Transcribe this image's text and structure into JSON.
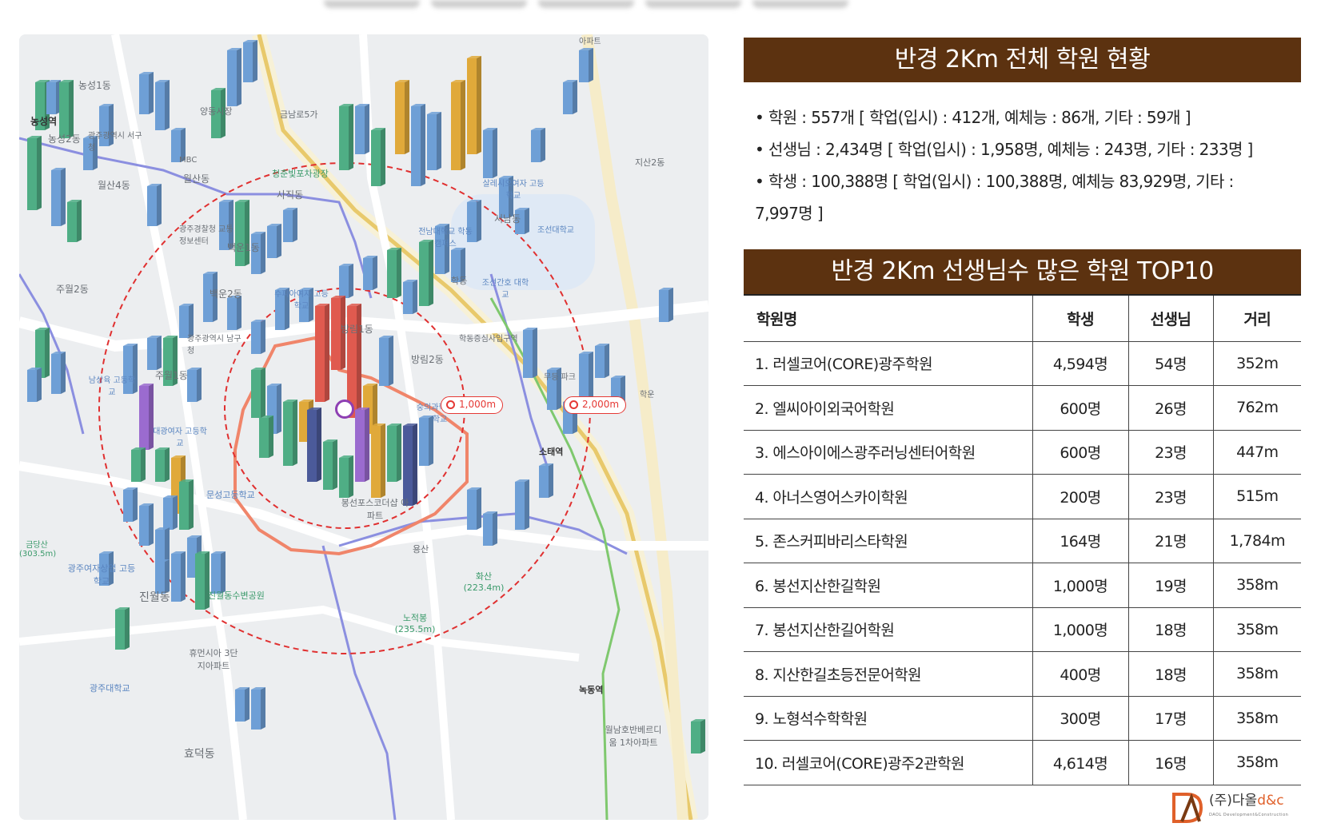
{
  "summary": {
    "title": "반경 2Km 전체 학원 현황",
    "lines": [
      "• 학원 : 557개 [ 학업(입시) : 412개, 예체능 : 86개, 기타 : 59개 ]",
      "• 선생님 : 2,434명 [ 학업(입시) : 1,958명, 예체능 : 243명, 기타 : 233명 ]",
      "• 학생 : 100,388명 [ 학업(입시) : 100,388명, 예체능 83,929명, 기타 :",
      "7,997명 ]"
    ]
  },
  "top10": {
    "title": "반경 2Km 선생님수 많은 학원 TOP10",
    "headers": [
      "학원명",
      "학생",
      "선생님",
      "거리"
    ],
    "rows": [
      {
        "name": "1. 러셀코어(CORE)광주학원",
        "students": "4,594명",
        "teachers": "54명",
        "distance": "352m"
      },
      {
        "name": "2. 엘씨아이외국어학원",
        "students": "600명",
        "teachers": "26명",
        "distance": "762m"
      },
      {
        "name": "3. 에스아이에스광주러닝센터어학원",
        "students": "600명",
        "teachers": "23명",
        "distance": "447m"
      },
      {
        "name": "4. 아너스영어스카이학원",
        "students": "200명",
        "teachers": "23명",
        "distance": "515m"
      },
      {
        "name": "5. 존스커피바리스타학원",
        "students": "164명",
        "teachers": "21명",
        "distance": "1,784m"
      },
      {
        "name": "6. 봉선지산한길학원",
        "students": "1,000명",
        "teachers": "19명",
        "distance": "358m"
      },
      {
        "name": "7. 봉선지산한길어학원",
        "students": "1,000명",
        "teachers": "18명",
        "distance": "358m"
      },
      {
        "name": "8. 지산한길초등전문어학원",
        "students": "400명",
        "teachers": "18명",
        "distance": "358m"
      },
      {
        "name": "9. 노형석수학학원",
        "students": "300명",
        "teachers": "17명",
        "distance": "358m"
      },
      {
        "name": "10. 러셀코어(CORE)광주2관학원",
        "students": "4,614명",
        "teachers": "16명",
        "distance": "358m"
      }
    ]
  },
  "map": {
    "radius_badges": [
      "1,000m",
      "2,000m"
    ],
    "labels": {
      "l1": "농성1동",
      "l2": "농성역",
      "l3": "농성2동",
      "l4": "광주광역시 서구청",
      "l5": "MBC",
      "l6": "월산동",
      "l7": "양동시장",
      "l8": "금남로5가",
      "l9": "청춘빛포차광장",
      "l10": "사직동",
      "l11": "광주경찰청 교통정보센터",
      "l12": "주월2동",
      "l13": "월산4동",
      "l14": "백운1동",
      "l15": "백운2동",
      "l16": "광주광역시 남구청",
      "l17": "주월1동",
      "l18": "방림1동",
      "l19": "방림2동",
      "l20": "봉선포스코더샵 아파트",
      "l21": "문성고등학교",
      "l22": "광주여자상업 고등학교",
      "l23": "진월동",
      "l24": "진월동수변공원",
      "l25": "휴먼시아 3단지아파트",
      "l26": "광주대학교",
      "l27": "효덕동",
      "l28": "용산",
      "l29": "서남동",
      "l30": "전남대학교 학동캠퍼스",
      "l31": "조선대학교",
      "l32": "살레시오여자 고등학교",
      "l33": "조선간호 대학교",
      "l34": "학동증심사입구역",
      "l35": "소태역",
      "l36": "녹동역",
      "l37": "월남호반베르디움 1차아파트",
      "l38": "지산2동",
      "l39": "학운",
      "l40": "숭의과학 고등학교",
      "l41": "수피아여자 고등학교",
      "l42": "대광여자 고등학교",
      "l43": "남상육 고등학교",
      "l44": "금당산 (303.5m)",
      "l45": "화산 (223.4m)",
      "l46": "노적봉 (235.5m)",
      "l47": "학동",
      "l48": "무등 파크",
      "l49": "아파트"
    }
  },
  "logo": {
    "name_prefix": "(주)다올",
    "name_suffix": "d&c",
    "sub": "DAOL Development&Construction"
  },
  "colors": {
    "header_bg": "#5c3210",
    "bar_blue": "#6e9fd6",
    "bar_green": "#4fae85",
    "bar_red": "#e05a4f",
    "bar_yellow": "#e0a93a",
    "bar_purple": "#9b6bcf",
    "bar_navy": "#4b5a9a"
  },
  "icons": [
    "map-pin-icon",
    "radius-icon",
    "logo-icon"
  ]
}
